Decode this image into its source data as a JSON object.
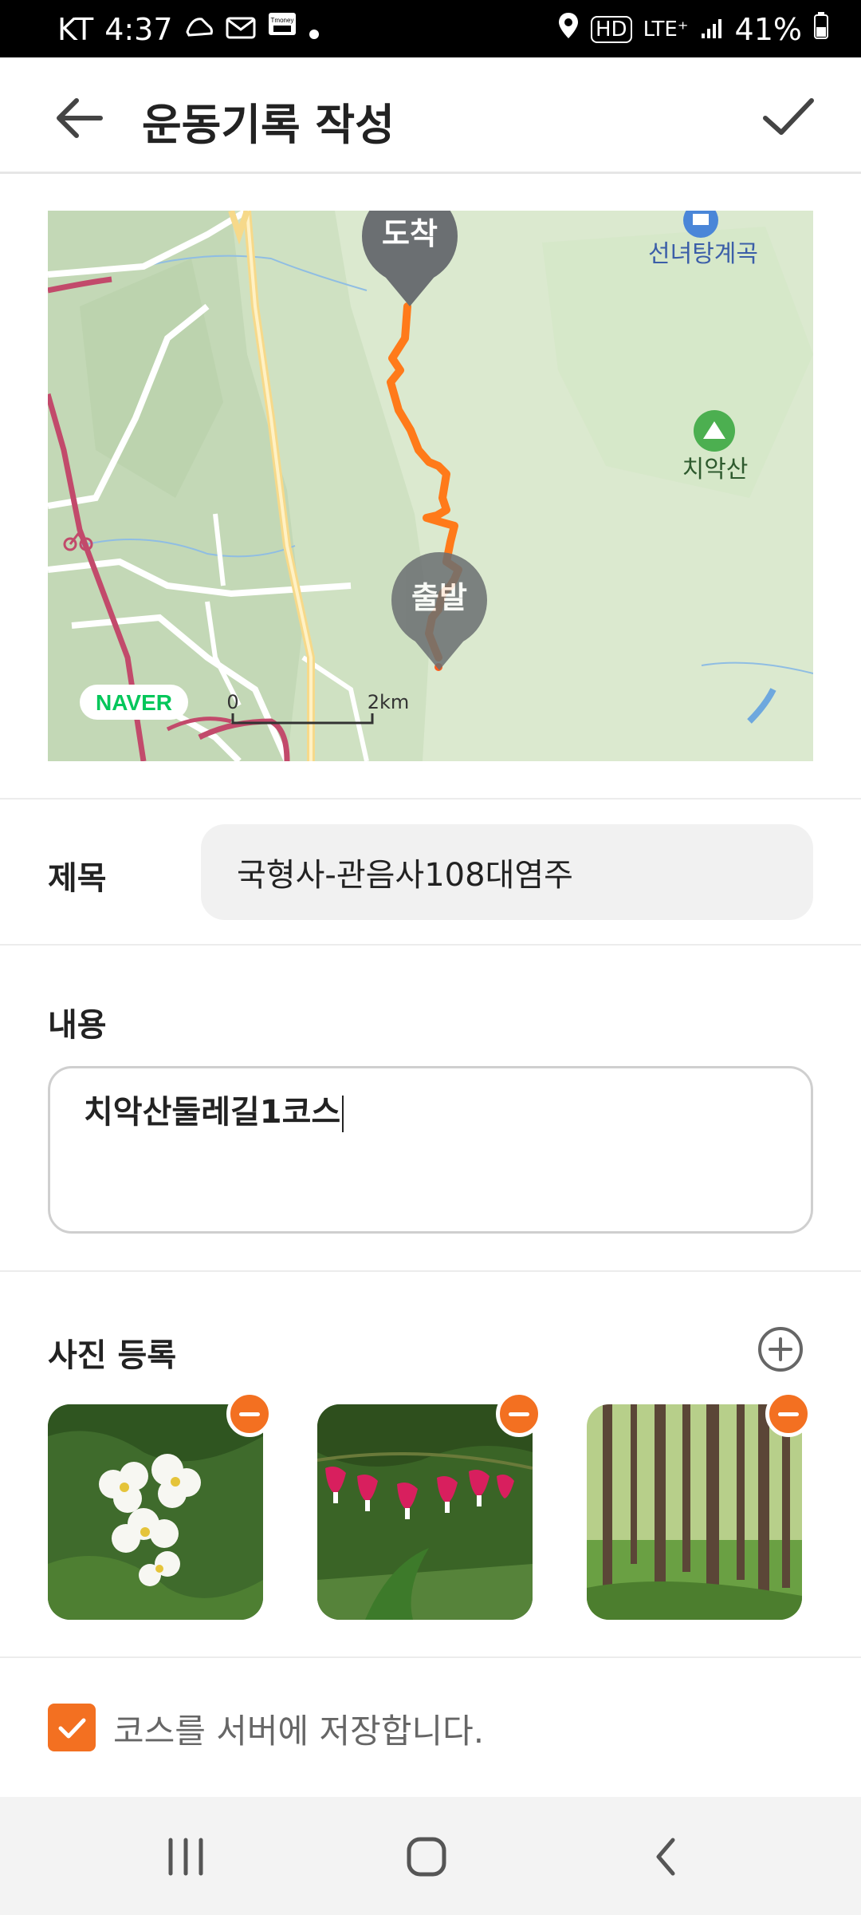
{
  "status_bar": {
    "carrier": "KT",
    "time": "4:37",
    "network": "LTE⁺",
    "hd": "HD",
    "battery": "41%",
    "tmoney": "Tmoney"
  },
  "app_bar": {
    "title": "운동기록 작성"
  },
  "map": {
    "labels": {
      "arrive": "도착",
      "depart": "출발",
      "valley": "선녀탕계곡",
      "mountain": "치악산",
      "brand": "NAVER",
      "scale_zero": "0",
      "scale_km": "2km"
    },
    "route_color": "#ff7a1a",
    "marker_color": "#6b6f72"
  },
  "form": {
    "title_label": "제목",
    "title_value": "국형사-관음사108대염주",
    "content_label": "내용",
    "content_value": "치악산둘레길1코스",
    "photo_label": "사진 등록",
    "save_course_label": "코스를 서버에 저장합니다.",
    "save_course_checked": true
  },
  "photos": [
    {
      "subject": "white flowers"
    },
    {
      "subject": "bleeding heart flowers"
    },
    {
      "subject": "forest trees"
    }
  ],
  "colors": {
    "accent": "#f37021"
  }
}
